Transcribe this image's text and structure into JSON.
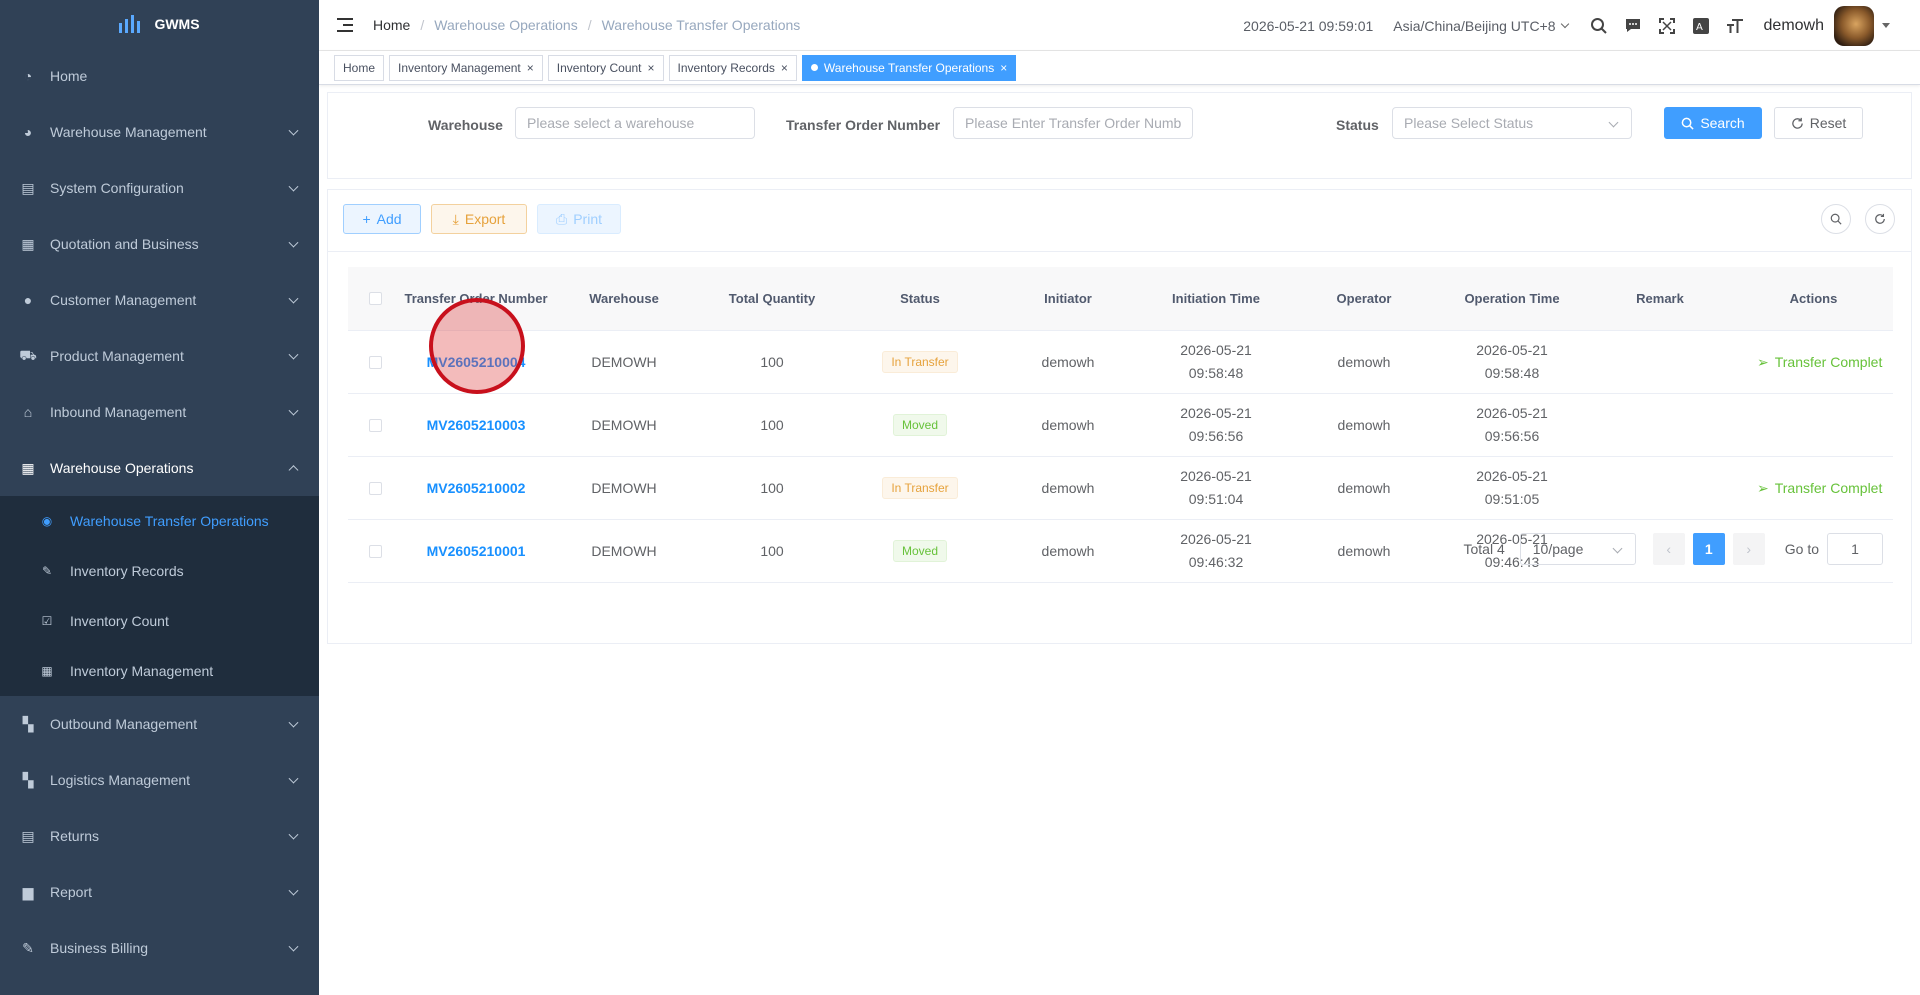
{
  "app": {
    "logo_text": "GWMS"
  },
  "sidebar": {
    "items": [
      {
        "label": "Home",
        "icon": "dashboard-icon"
      },
      {
        "label": "Warehouse Management",
        "icon": "pie-chart-icon"
      },
      {
        "label": "System Configuration",
        "icon": "config-icon"
      },
      {
        "label": "Quotation and Business",
        "icon": "document-icon"
      },
      {
        "label": "Customer Management",
        "icon": "user-icon"
      },
      {
        "label": "Product Management",
        "icon": "cart-icon"
      },
      {
        "label": "Inbound Management",
        "icon": "house-icon"
      },
      {
        "label": "Warehouse Operations",
        "icon": "table-icon"
      },
      {
        "label": "Outbound Management",
        "icon": "grid-icon"
      },
      {
        "label": "Logistics Management",
        "icon": "grid-icon"
      },
      {
        "label": "Returns",
        "icon": "document-icon"
      },
      {
        "label": "Report",
        "icon": "bar-chart-icon"
      },
      {
        "label": "Business Billing",
        "icon": "edit-icon"
      }
    ],
    "submenu": [
      {
        "label": "Warehouse Transfer Operations",
        "icon": "eye-icon",
        "active": true
      },
      {
        "label": "Inventory Records",
        "icon": "edit-icon"
      },
      {
        "label": "Inventory Count",
        "icon": "checkbox-icon"
      },
      {
        "label": "Inventory Management",
        "icon": "table-icon"
      }
    ]
  },
  "header": {
    "breadcrumb": [
      "Home",
      "Warehouse Operations",
      "Warehouse Transfer Operations"
    ],
    "datetime": "2026-05-21 09:59:01",
    "timezone": "Asia/China/Beijing UTC+8",
    "username": "demowh"
  },
  "tags": [
    {
      "label": "Home"
    },
    {
      "label": "Inventory Management"
    },
    {
      "label": "Inventory Count"
    },
    {
      "label": "Inventory Records"
    },
    {
      "label": "Warehouse Transfer Operations",
      "active": true
    }
  ],
  "search": {
    "warehouse_label": "Warehouse",
    "warehouse_placeholder": "Please select a warehouse",
    "order_label": "Transfer Order Number",
    "order_placeholder": "Please Enter Transfer Order Numb",
    "status_label": "Status",
    "status_placeholder": "Please Select Status",
    "search_button": "Search",
    "reset_button": "Reset"
  },
  "toolbar": {
    "add": "Add",
    "export": "Export",
    "print": "Print"
  },
  "table": {
    "columns": [
      "Transfer Order Number",
      "Warehouse",
      "Total Quantity",
      "Status",
      "Initiator",
      "Initiation Time",
      "Operator",
      "Operation Time",
      "Remark",
      "Actions"
    ],
    "rows": [
      {
        "order": "MV2605210004",
        "warehouse": "DEMOWH",
        "qty": "100",
        "status": "In Transfer",
        "initiator": "demowh",
        "init_date": "2026-05-21",
        "init_time": "09:58:48",
        "operator": "demowh",
        "op_date": "2026-05-21",
        "op_time": "09:58:48",
        "remark": "",
        "action": "Transfer Complet"
      },
      {
        "order": "MV2605210003",
        "warehouse": "DEMOWH",
        "qty": "100",
        "status": "Moved",
        "initiator": "demowh",
        "init_date": "2026-05-21",
        "init_time": "09:56:56",
        "operator": "demowh",
        "op_date": "2026-05-21",
        "op_time": "09:56:56",
        "remark": "",
        "action": ""
      },
      {
        "order": "MV2605210002",
        "warehouse": "DEMOWH",
        "qty": "100",
        "status": "In Transfer",
        "initiator": "demowh",
        "init_date": "2026-05-21",
        "init_time": "09:51:04",
        "operator": "demowh",
        "op_date": "2026-05-21",
        "op_time": "09:51:05",
        "remark": "",
        "action": "Transfer Complet"
      },
      {
        "order": "MV2605210001",
        "warehouse": "DEMOWH",
        "qty": "100",
        "status": "Moved",
        "initiator": "demowh",
        "init_date": "2026-05-21",
        "init_time": "09:46:32",
        "operator": "demowh",
        "op_date": "2026-05-21",
        "op_time": "09:46:43",
        "remark": "",
        "action": ""
      }
    ]
  },
  "pagination": {
    "total": "Total 4",
    "page_size": "10/page",
    "current_page": "1",
    "goto_label": "Go to",
    "goto_value": "1"
  },
  "colors": {
    "primary": "#409eff",
    "sidebar_bg": "#304156",
    "submenu_bg": "#1f2d3d",
    "warning": "#e6a23c",
    "success": "#67c23a"
  }
}
